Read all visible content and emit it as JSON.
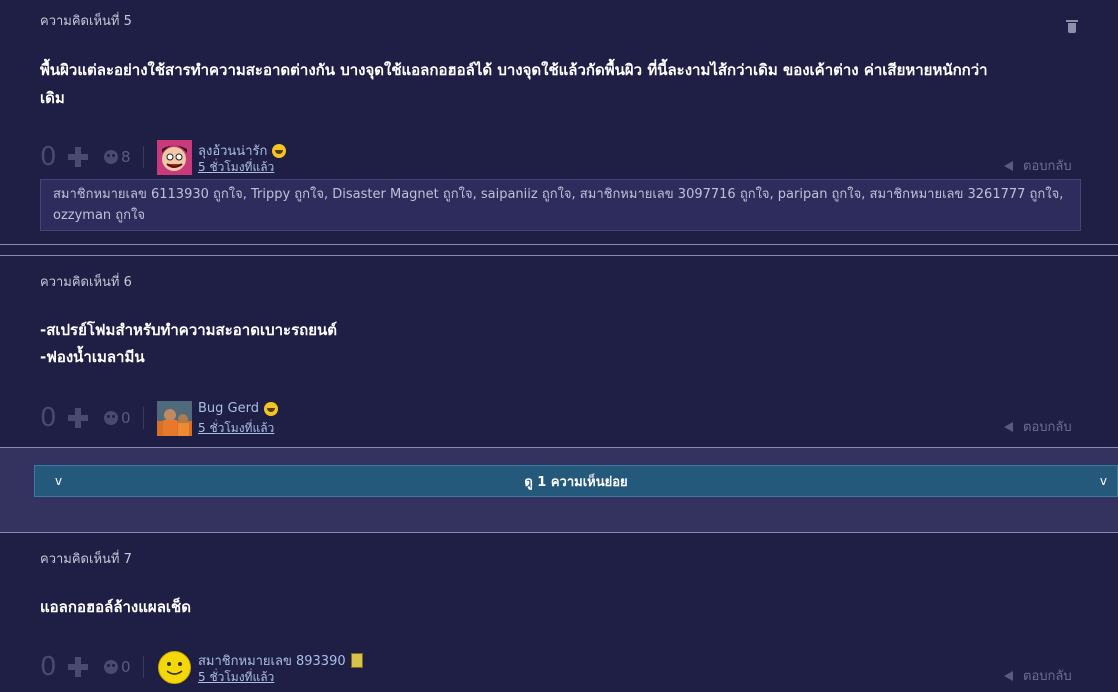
{
  "colors": {
    "background": "#1f1e45",
    "panel": "#2d2c5c",
    "accent_button": "#25597c",
    "username": "#a9bfe6"
  },
  "comments": [
    {
      "title": "ความคิดเห็นที่ 5",
      "body": [
        "พื้นผิวแต่ละอย่างใช้สารทำความสะอาดต่างกัน บางจุดใช้แอลกอฮอล์ได้ บางจุดใช้แล้วกัดพื้นผิว ที่นี้ละงามไส้กว่าเดิม ของเค้าต่าง ค่าเสียหายหนักกว่า",
        "เดิม"
      ],
      "votes": "0",
      "emotions": "8",
      "user": "ลุงอ้วนน่ารัก",
      "time": "5 ชั่วโมงที่แล้ว",
      "reply": "ตอบกลับ",
      "likes": "สมาชิกหมายเลข 6113930 ถูกใจ, Trippy ถูกใจ, Disaster Magnet ถูกใจ, saipaniiz ถูกใจ, สมาชิกหมายเลข 3097716 ถูกใจ, paripan ถูกใจ, สมาชิกหมายเลข 3261777 ถูกใจ, ozzyman ถูกใจ",
      "icons": {
        "badge": "grinning-face-icon",
        "delete": "trash-icon"
      }
    },
    {
      "title": "ความคิดเห็นที่ 6",
      "body": [
        "-สเปรย์โฟมสำหรับทำความสะอาดเบาะรถยนต์",
        "-ฟองน้ำเมลามีน"
      ],
      "votes": "0",
      "emotions": "0",
      "user": "Bug Gerd",
      "time": "5 ชั่วโมงที่แล้ว",
      "reply": "ตอบกลับ",
      "icons": {
        "badge": "grinning-face-icon"
      }
    },
    {
      "title": "ความคิดเห็นที่ 7",
      "body": [
        "แอลกอฮอล์ล้างแผลเช็ด"
      ],
      "votes": "0",
      "emotions": "0",
      "user": "สมาชิกหมายเลข 893390",
      "time": "5 ชั่วโมงที่แล้ว",
      "reply": "ตอบกลับ",
      "icons": {
        "badge": "mobile-phone-icon"
      }
    }
  ],
  "sub_replies": {
    "label": "ดู 1 ความเห็นย่อย",
    "chevron": "v"
  }
}
